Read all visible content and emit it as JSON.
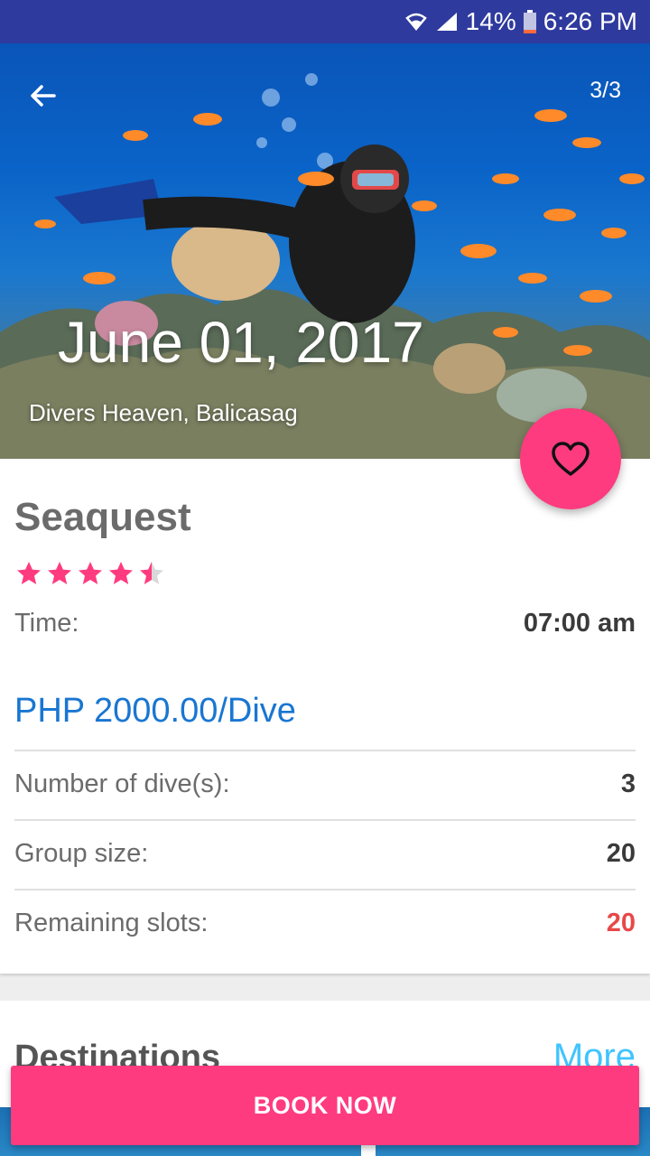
{
  "status_bar": {
    "battery": "14%",
    "time": "6:26 PM",
    "icons": [
      "wifi-icon",
      "signal-icon",
      "battery-icon"
    ]
  },
  "hero": {
    "page_counter": "3/3",
    "date": "June 01, 2017",
    "location": "Divers Heaven, Balicasag",
    "back_icon": "arrow-back-icon"
  },
  "favorite": {
    "icon": "heart-outline-icon"
  },
  "details": {
    "title": "Seaquest",
    "rating": 4.5,
    "rating_max": 5,
    "time_label": "Time:",
    "time_value": "07:00 am",
    "price": "PHP 2000.00/Dive",
    "dives_label": "Number of dive(s):",
    "dives_value": "3",
    "group_label": "Group size:",
    "group_value": "20",
    "slots_label": "Remaining slots:",
    "slots_value": "20"
  },
  "destinations": {
    "title": "Destinations",
    "more": "More"
  },
  "book_button": {
    "label": "BOOK NOW"
  },
  "colors": {
    "status_bar": "#2f3a9e",
    "accent_pink": "#ff3b7f",
    "price_blue": "#1976d2",
    "slots_red": "#e84848",
    "more_link": "#40c4ff",
    "star": "#ff3b7f"
  }
}
